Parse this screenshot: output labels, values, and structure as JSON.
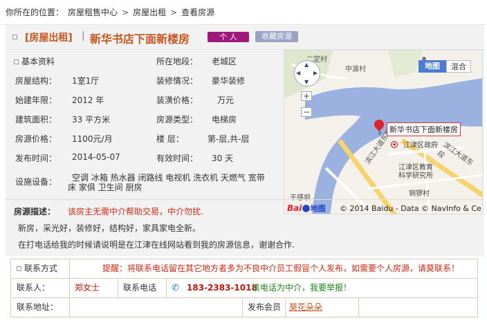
{
  "breadcrumb": {
    "label": "你所在的位置：",
    "items": [
      "房屋租售中心",
      "房屋出租",
      "查看房源"
    ],
    "separator": ">"
  },
  "title": {
    "tag": "[房屋出租]",
    "separator": "|",
    "name": "新华书店下面新楼房",
    "personal_badge": "个 人",
    "favorite_button": "收藏房源"
  },
  "details": {
    "section_label": "基本资料",
    "location_label": "所在地段：",
    "location_value": "老城区",
    "structure_label": "房屋结构：",
    "structure_value": "1室1厅",
    "decor_label": "装修情况：",
    "decor_value": "豪华装修",
    "year_label": "始建年限：",
    "year_value": "2012  年",
    "decor_price_label": "装潢价格：",
    "decor_price_value": "万元",
    "area_label": "建筑面积：",
    "area_value": "33  平方米",
    "type_label": "房源类型：",
    "type_value": "电梯房",
    "price_label": "房源价格：",
    "price_value": "1100元/月",
    "floor_label": "楼  层：",
    "floor_value": "第-层,共-层",
    "publish_label": "发布时间：",
    "publish_value": "2014-05-07",
    "valid_label": "有效时间：",
    "valid_value": "30  天",
    "facilities_label": "设施设备：",
    "facilities_line1": "空调 冰箱 热水器 闭路线 电视机 洗衣机 天燃气 宽带",
    "facilities_line2": "床 家俱 卫生间 厨房"
  },
  "map": {
    "view_map": "地图",
    "view_hybrid": "混合",
    "zoom_in": "+",
    "zoom_out": "−",
    "marker_label": "新华书店下面新楼房",
    "labels": {
      "erding": "二定村",
      "zhongdu": "中渡村",
      "government": "江津区政府",
      "education": "江津区教育",
      "science": "科学研究所",
      "road1": "滨江大道东段",
      "road2": "滨江大道东段",
      "street": "铜锣村",
      "ganli": "干感坝"
    },
    "copyright": "© 2014 Baidu - Data © NavInfo & Ce",
    "logo": "Bai",
    "logo2": "地图"
  },
  "description": {
    "label": "房源描述：",
    "warning": "该房主无需中介帮助交易，中介勿扰.",
    "line1": "新房，采光好，装修好，结构好，家具家电全新。",
    "line2": "在打电话给我的时候请说明是在江津在线网站看到我的房源信息，谢谢合作."
  },
  "contact": {
    "method_label": "联系方式",
    "notice": "提醒：将联系电话留在其它地方者多为不良中介员工假冒个人发布，如需要个人房源，请莫联系！",
    "person_label": "联系人：",
    "person_value": "郑女士",
    "phone_label": "联系电话",
    "phone_value": "183-2383-1018",
    "report": "该电话为中介，我要举报！",
    "address_label": "联系地址：",
    "member_label": "发布会员",
    "member_value": "葵花朵朵"
  },
  "colors": {
    "accent": "#c9541e",
    "badge": "#a0197a",
    "favorite": "#9aa3c6",
    "warning": "#d3280f",
    "water": "#9bb2e0",
    "phone": "#c4160c"
  }
}
